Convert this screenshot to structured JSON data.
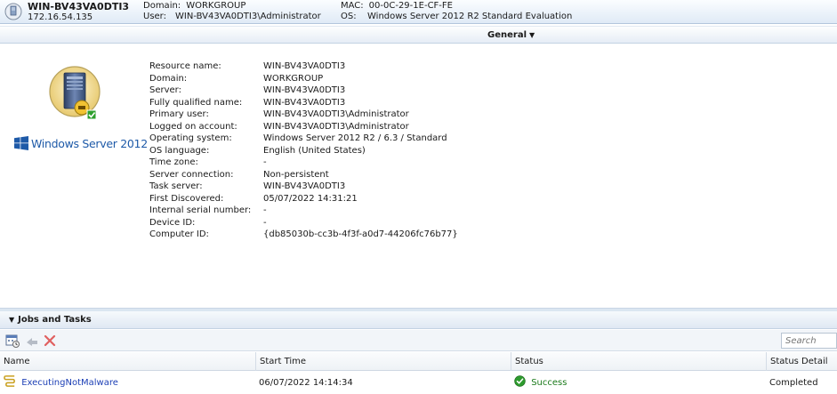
{
  "header": {
    "computer_name": "WIN-BV43VA0DTI3",
    "ip": "172.16.54.135",
    "domain_label": "Domain:",
    "domain_value": "WORKGROUP",
    "user_label": "User:",
    "user_value": "WIN-BV43VA0DTI3\\Administrator",
    "mac_label": "MAC:",
    "mac_value": "00-0C-29-1E-CF-FE",
    "os_label": "OS:",
    "os_value": "Windows Server 2012 R2 Standard Evaluation"
  },
  "general_menu": {
    "label": "General",
    "icon": "caret-down-icon"
  },
  "os_brand": {
    "text": "Windows Server 2012",
    "logo_color": "#1e5aa8"
  },
  "properties": [
    {
      "key": "Resource name:",
      "value": "WIN-BV43VA0DTI3"
    },
    {
      "key": "Domain:",
      "value": "WORKGROUP"
    },
    {
      "key": "Server:",
      "value": "WIN-BV43VA0DTI3"
    },
    {
      "key": "Fully qualified name:",
      "value": "WIN-BV43VA0DTI3"
    },
    {
      "key": "Primary user:",
      "value": "WIN-BV43VA0DTI3\\Administrator"
    },
    {
      "key": "Logged on account:",
      "value": "WIN-BV43VA0DTI3\\Administrator"
    },
    {
      "key": "Operating system:",
      "value": "Windows Server 2012 R2 / 6.3 / Standard"
    },
    {
      "key": "OS language:",
      "value": "English (United States)"
    },
    {
      "key": "Time zone:",
      "value": "-"
    },
    {
      "key": "Server connection:",
      "value": "Non-persistent"
    },
    {
      "key": "Task server:",
      "value": "WIN-BV43VA0DTI3"
    },
    {
      "key": "First Discovered:",
      "value": "05/07/2022 14:31:21"
    },
    {
      "key": "Internal serial number:",
      "value": "-"
    },
    {
      "key": "Device ID:",
      "value": "-"
    },
    {
      "key": "Computer ID:",
      "value": "{db85030b-cc3b-4f3f-a0d7-44206fc76b77}"
    }
  ],
  "jobs": {
    "title": "Jobs and Tasks",
    "search_placeholder": "Search",
    "toolbar": [
      "schedule-task-icon",
      "rerun-icon",
      "delete-icon"
    ],
    "columns": [
      "Name",
      "Start Time",
      "Status",
      "Status Detail"
    ],
    "rows": [
      {
        "name": "ExecutingNotMalware",
        "start_time": "06/07/2022 14:14:34",
        "status": "Success",
        "status_detail": "Completed"
      }
    ]
  },
  "colors": {
    "link": "#1c3fb5",
    "success": "#1b7a1b",
    "header_bg": "#dfeaf6"
  }
}
